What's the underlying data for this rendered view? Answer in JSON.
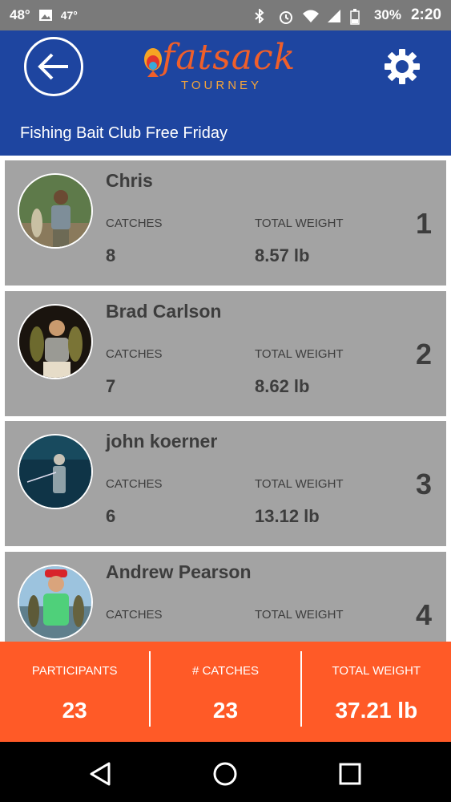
{
  "status_bar": {
    "temp_current": "48°",
    "temp_secondary": "47°",
    "battery": "30%",
    "time": "2:20",
    "icons": [
      "image-icon",
      "bluetooth-icon",
      "alarm-icon",
      "wifi-icon",
      "signal-icon",
      "battery-icon"
    ]
  },
  "header": {
    "logo_text": "fatsack",
    "logo_sub": "TOURNEY",
    "event_title": "Fishing Bait Club Free Friday",
    "back_icon": "back-arrow-icon",
    "settings_icon": "gear-icon"
  },
  "leaderboard": {
    "catches_label": "CATCHES",
    "weight_label": "TOTAL WEIGHT",
    "entries": [
      {
        "name": "Chris",
        "catches": "8",
        "weight": "8.57 lb",
        "rank": "1"
      },
      {
        "name": "Brad Carlson",
        "catches": "7",
        "weight": "8.62 lb",
        "rank": "2"
      },
      {
        "name": "john koerner",
        "catches": "6",
        "weight": "13.12 lb",
        "rank": "3"
      },
      {
        "name": "Andrew Pearson",
        "catches": "",
        "weight": "",
        "rank": "4"
      }
    ]
  },
  "summary": {
    "participants_label": "PARTICIPANTS",
    "participants_value": "23",
    "catches_label": "# CATCHES",
    "catches_value": "23",
    "weight_label": "TOTAL WEIGHT",
    "weight_value": "37.21 lb"
  },
  "colors": {
    "app_bar": "#1e45a0",
    "card": "#a3a3a3",
    "summary": "#ff5a27",
    "status_bar": "#7a7a7a"
  }
}
